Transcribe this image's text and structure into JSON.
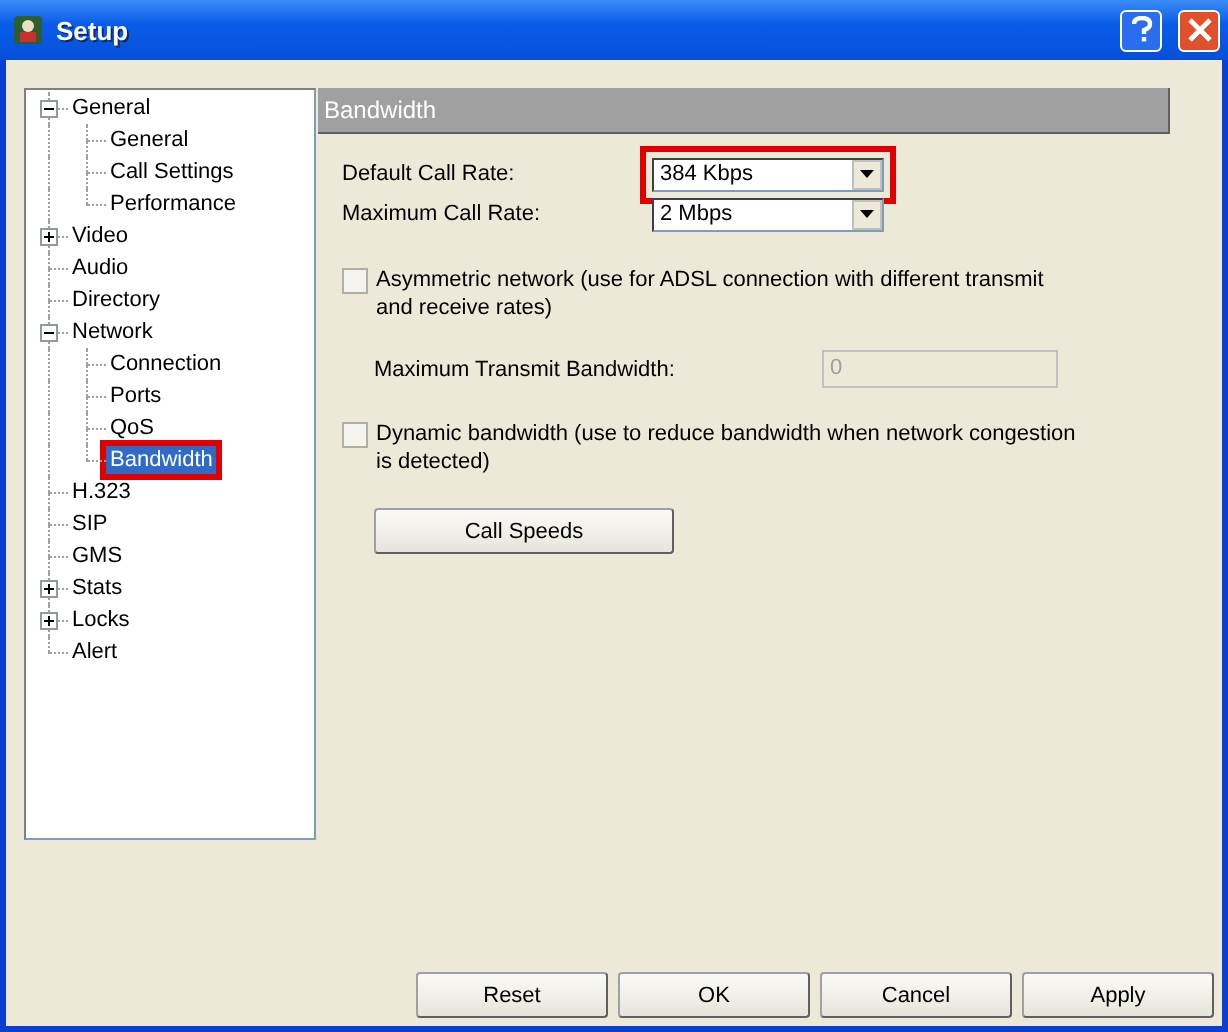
{
  "window": {
    "title": "Setup"
  },
  "tree": [
    {
      "label": "General",
      "expanded": true,
      "selected": false,
      "children": [
        {
          "label": "General",
          "selected": false
        },
        {
          "label": "Call Settings",
          "selected": false
        },
        {
          "label": "Performance",
          "selected": false
        }
      ]
    },
    {
      "label": "Video",
      "expanded": false,
      "selected": false
    },
    {
      "label": "Audio",
      "selected": false
    },
    {
      "label": "Directory",
      "selected": false
    },
    {
      "label": "Network",
      "expanded": true,
      "selected": false,
      "children": [
        {
          "label": "Connection",
          "selected": false
        },
        {
          "label": "Ports",
          "selected": false
        },
        {
          "label": "QoS",
          "selected": false
        },
        {
          "label": "Bandwidth",
          "selected": true,
          "highlighted": true
        }
      ]
    },
    {
      "label": "H.323",
      "selected": false
    },
    {
      "label": "SIP",
      "selected": false
    },
    {
      "label": "GMS",
      "selected": false
    },
    {
      "label": "Stats",
      "expanded": false,
      "selected": false
    },
    {
      "label": "Locks",
      "expanded": false,
      "selected": false
    },
    {
      "label": "Alert",
      "selected": false
    }
  ],
  "panel": {
    "title": "Bandwidth",
    "rates": [
      {
        "label": "Default Call Rate:",
        "value": "384 Kbps",
        "highlighted": true
      },
      {
        "label": "Maximum Call Rate:",
        "value": "2 Mbps",
        "highlighted": false
      }
    ],
    "asymmetric": {
      "label": "Asymmetric network (use for ADSL connection with different transmit and receive rates)",
      "checked": false
    },
    "transmit": {
      "label": "Maximum Transmit Bandwidth:",
      "value": "0",
      "disabled": true
    },
    "dynamic": {
      "label": "Dynamic bandwidth (use to reduce bandwidth when network congestion is detected)",
      "checked": false
    },
    "call_speeds_button": "Call Speeds"
  },
  "buttons": [
    "Reset",
    "OK",
    "Cancel",
    "Apply"
  ]
}
